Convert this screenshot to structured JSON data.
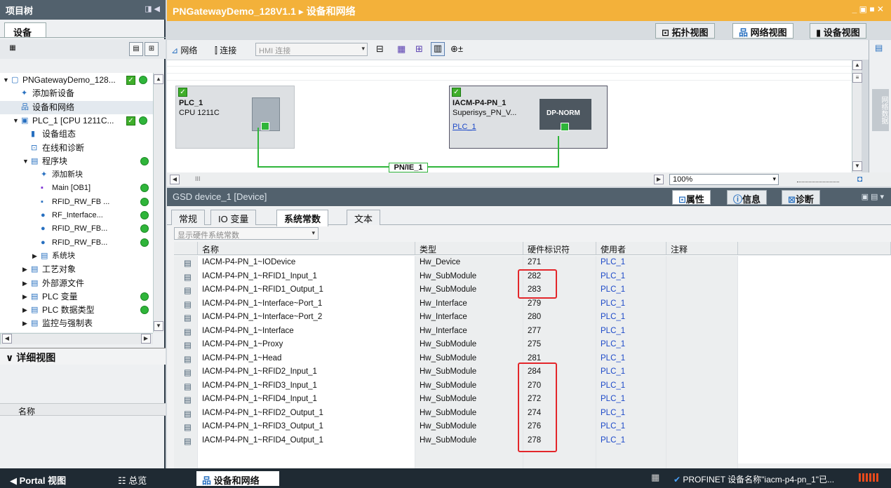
{
  "left_panel": {
    "title": "项目树",
    "tab": "设备",
    "tree": [
      {
        "label": "PNGatewayDemo_128...",
        "level": 0
      },
      {
        "label": "添加新设备",
        "level": 1
      },
      {
        "label": "设备和网络",
        "level": 1
      },
      {
        "label": "PLC_1 [CPU 1211C...",
        "level": 1
      },
      {
        "label": "设备组态",
        "level": 2
      },
      {
        "label": "在线和诊断",
        "level": 2
      },
      {
        "label": "程序块",
        "level": 2
      },
      {
        "label": "添加新块",
        "level": 3
      },
      {
        "label": "Main [OB1]",
        "level": 3
      },
      {
        "label": "RFID_RW_FB ...",
        "level": 3
      },
      {
        "label": "RF_Interface...",
        "level": 3
      },
      {
        "label": "RFID_RW_FB...",
        "level": 3
      },
      {
        "label": "RFID_RW_FB...",
        "level": 3
      },
      {
        "label": "系统块",
        "level": 3
      },
      {
        "label": "工艺对象",
        "level": 2
      },
      {
        "label": "外部源文件",
        "level": 2
      },
      {
        "label": "PLC 变量",
        "level": 2
      },
      {
        "label": "PLC 数据类型",
        "level": 2
      },
      {
        "label": "监控与强制表",
        "level": 2
      }
    ],
    "detail_title": "详细视图",
    "detail_col": "名称"
  },
  "editor": {
    "title": "PNGatewayDemo_128V1.1",
    "breadcrumb": "设备和网络",
    "view_tabs": [
      "拓扑视图",
      "网络视图",
      "设备视图"
    ],
    "toolbar": {
      "network": "网络",
      "connect": "连接",
      "hmi_conn": "HMI 连接"
    },
    "devices": [
      {
        "name": "PLC_1",
        "type": "CPU 1211C"
      },
      {
        "name": "IACM-P4-PN_1",
        "type": "Superisys_PN_V...",
        "link": "PLC_1",
        "module": "DP-NORM"
      }
    ],
    "network_label": "PN/IE_1",
    "zoom": "100%",
    "side_tab": "网络数据"
  },
  "props": {
    "title": "GSD device_1 [Device]",
    "tabs": [
      "属性",
      "信息",
      "诊断"
    ],
    "subtabs": [
      "常规",
      "IO 变量",
      "系统常数",
      "文本"
    ],
    "filter": "显示硬件系统常数",
    "columns": [
      "名称",
      "类型",
      "硬件标识符",
      "使用者",
      "注释"
    ],
    "rows": [
      {
        "name": "IACM-P4-PN_1~IODevice",
        "type": "Hw_Device",
        "hwid": "271",
        "user": "PLC_1"
      },
      {
        "name": "IACM-P4-PN_1~RFID1_Input_1",
        "type": "Hw_SubModule",
        "hwid": "282",
        "user": "PLC_1"
      },
      {
        "name": "IACM-P4-PN_1~RFID1_Output_1",
        "type": "Hw_SubModule",
        "hwid": "283",
        "user": "PLC_1"
      },
      {
        "name": "IACM-P4-PN_1~Interface~Port_1",
        "type": "Hw_Interface",
        "hwid": "279",
        "user": "PLC_1"
      },
      {
        "name": "IACM-P4-PN_1~Interface~Port_2",
        "type": "Hw_Interface",
        "hwid": "280",
        "user": "PLC_1"
      },
      {
        "name": "IACM-P4-PN_1~Interface",
        "type": "Hw_Interface",
        "hwid": "277",
        "user": "PLC_1"
      },
      {
        "name": "IACM-P4-PN_1~Proxy",
        "type": "Hw_SubModule",
        "hwid": "275",
        "user": "PLC_1"
      },
      {
        "name": "IACM-P4-PN_1~Head",
        "type": "Hw_SubModule",
        "hwid": "281",
        "user": "PLC_1"
      },
      {
        "name": "IACM-P4-PN_1~RFID2_Input_1",
        "type": "Hw_SubModule",
        "hwid": "284",
        "user": "PLC_1"
      },
      {
        "name": "IACM-P4-PN_1~RFID3_Input_1",
        "type": "Hw_SubModule",
        "hwid": "270",
        "user": "PLC_1"
      },
      {
        "name": "IACM-P4-PN_1~RFID4_Input_1",
        "type": "Hw_SubModule",
        "hwid": "272",
        "user": "PLC_1"
      },
      {
        "name": "IACM-P4-PN_1~RFID2_Output_1",
        "type": "Hw_SubModule",
        "hwid": "274",
        "user": "PLC_1"
      },
      {
        "name": "IACM-P4-PN_1~RFID3_Output_1",
        "type": "Hw_SubModule",
        "hwid": "276",
        "user": "PLC_1"
      },
      {
        "name": "IACM-P4-PN_1~RFID4_Output_1",
        "type": "Hw_SubModule",
        "hwid": "278",
        "user": "PLC_1"
      }
    ]
  },
  "status": {
    "portal": "Portal 视图",
    "overview": "总览",
    "current": "设备和网络",
    "message": "PROFINET 设备名称\"iacm-p4-pn_1\"已..."
  },
  "colors": {
    "accent": "#f3b13a",
    "panel_header": "#52616d",
    "link": "#1b48c8",
    "ok": "#2fb53a",
    "highlight": "#e3262a"
  }
}
